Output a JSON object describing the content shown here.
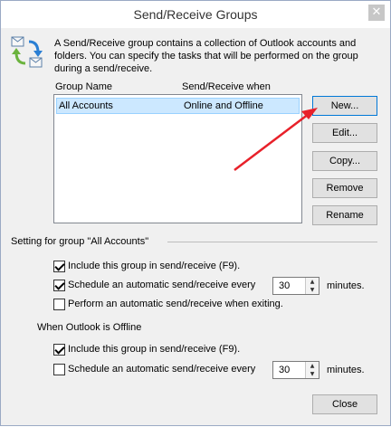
{
  "window": {
    "title": "Send/Receive Groups",
    "close_glyph": "✕"
  },
  "intro": {
    "icon": "send-receive-sync-icon",
    "text": "A Send/Receive group contains a collection of Outlook accounts and folders. You can specify the tasks that will be performed on the group during a send/receive."
  },
  "groups_list": {
    "columns": [
      "Group Name",
      "Send/Receive when"
    ],
    "rows": [
      {
        "name": "All Accounts",
        "when": "Online and Offline",
        "selected": true
      }
    ]
  },
  "buttons": {
    "new": "New...",
    "edit": "Edit...",
    "copy": "Copy...",
    "remove": "Remove",
    "rename": "Rename",
    "close": "Close"
  },
  "settings": {
    "heading": "Setting for group \"All Accounts\"",
    "online": {
      "include": {
        "label": "Include this group in send/receive (F9).",
        "checked": true
      },
      "schedule": {
        "label": "Schedule an automatic send/receive every",
        "checked": true,
        "value": "30",
        "units": "minutes."
      },
      "on_exit": {
        "label": "Perform an automatic send/receive when exiting.",
        "checked": false
      }
    },
    "offline_heading": "When Outlook is Offline",
    "offline": {
      "include": {
        "label": "Include this group in send/receive (F9).",
        "checked": true
      },
      "schedule": {
        "label": "Schedule an automatic send/receive every",
        "checked": false,
        "value": "30",
        "units": "minutes."
      }
    }
  },
  "colors": {
    "selection_bg": "#cce8ff",
    "selection_border": "#99d1ff",
    "annotation_arrow": "#e8212a",
    "default_button_border": "#0078d7"
  }
}
